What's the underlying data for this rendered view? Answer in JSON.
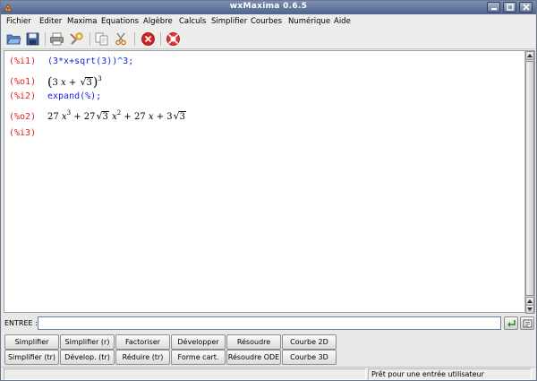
{
  "window": {
    "title": "wxMaxima 0.6.5"
  },
  "menubar": {
    "items": [
      {
        "label": "Fichier"
      },
      {
        "label": "Editer"
      },
      {
        "label": "Maxima"
      },
      {
        "label": "Equations"
      },
      {
        "label": "Algèbre"
      },
      {
        "label": "Calculs"
      },
      {
        "label": "Simplifier"
      },
      {
        "label": "Courbes"
      },
      {
        "label": "Numérique"
      },
      {
        "label": "Aide"
      }
    ]
  },
  "toolbar": {
    "icons": [
      "open-icon",
      "save-icon",
      "print-icon",
      "preferences-icon",
      "copy-icon",
      "cut-icon",
      "interrupt-icon",
      "help-icon"
    ]
  },
  "worksheet": {
    "cells": [
      {
        "label": "(%i1)",
        "type": "input",
        "content": "(3*x+sqrt(3))^3;"
      },
      {
        "label": "(%o1)",
        "type": "output"
      },
      {
        "label": "(%i2)",
        "type": "input",
        "content": "expand(%);"
      },
      {
        "label": "(%o2)",
        "type": "output"
      },
      {
        "label": "(%i3)",
        "type": "input",
        "content": ""
      }
    ],
    "o1": {
      "x_coef": "3",
      "var": "x",
      "plus": "+",
      "radicand": "3",
      "exponent": "3"
    },
    "o2": {
      "t1_coef": "27",
      "t1_var": "x",
      "t1_exp": "3",
      "plus1": "+",
      "t2_coef": "27",
      "t2_rad": "3",
      "t2_var": "x",
      "t2_exp": "2",
      "plus2": "+",
      "t3_coef": "27",
      "t3_var": "x",
      "plus3": "+",
      "t4_coef": "3",
      "t4_rad": "3"
    }
  },
  "entry": {
    "label": "ENTREE :",
    "value": ""
  },
  "buttons": {
    "row1": [
      "Simplifier",
      "Simplifier (r)",
      "Factoriser",
      "Développer",
      "Résoudre",
      "Courbe 2D"
    ],
    "row2": [
      "Simplifier (tr)",
      "Dévelop. (tr)",
      "Réduire (tr)",
      "Forme cart.",
      "Résoudre ODE",
      "Courbe 3D"
    ]
  },
  "status": {
    "text": "Prêt pour une entrée utilisateur"
  },
  "colors": {
    "input_label": "#e02020",
    "input_text": "#1a1ae0",
    "title_bar": "#5b6e95"
  }
}
